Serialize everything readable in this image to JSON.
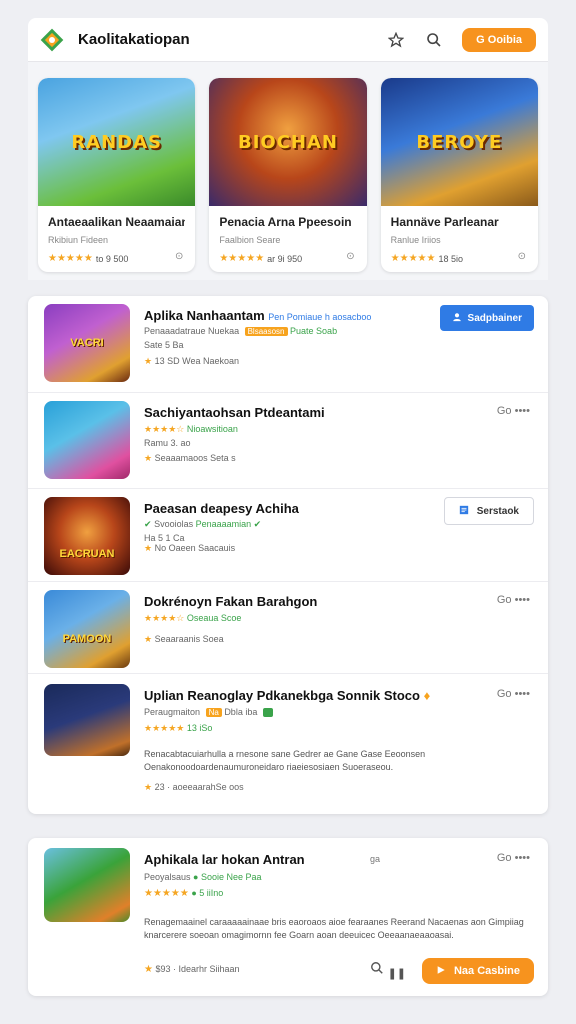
{
  "header": {
    "title": "Kaolitakatiopan",
    "star_icon": "star-outline-icon",
    "search_icon": "search-icon",
    "button_label": "G Ooibia"
  },
  "featured": [
    {
      "art_text": "RANDAS",
      "title": "Antaeaalikan Neaamaian",
      "sub": "Rkibiun Fideen",
      "stars": "★★★★★",
      "rating": "to 9 500",
      "more": "⊙",
      "colors": [
        "#4aa3e0",
        "#6bbf3a"
      ]
    },
    {
      "art_text": "BIOCHAN",
      "title": "Penacia Arna Ppeesoin",
      "sub": "Faalbion Seare",
      "stars": "★★★★★",
      "rating": "ar 9i 950",
      "more": "⊙",
      "colors": [
        "#b8461a",
        "#3a2a6a"
      ]
    },
    {
      "art_text": "BEROYE",
      "title": "Hannäve Parleanar",
      "sub": "Ranlue Iriios",
      "stars": "★★★★★",
      "rating": "18 5io",
      "more": "⊙",
      "colors": [
        "#2a5bb8",
        "#e0a030"
      ]
    }
  ],
  "list": [
    {
      "name": "Aplika Nanhaantam",
      "name_extra": "Pen Pomiaue h aosacboo",
      "meta1": "Penaaadatraue Nuekaa",
      "meta1_tag": "Blsaasosn",
      "meta1_extra": "Puate Soab",
      "meta2": "Sate 5 Ba",
      "meta3": "13 SD Wea Naekoan",
      "art_text": "VACRI",
      "button": "Sadpbainer",
      "colors": [
        "#8a3ec0",
        "#e0a030"
      ]
    },
    {
      "name": "Sachiyantaohsan Ptdeantami",
      "meta1": "★★★★☆",
      "meta1_green": "Nioawsitioan",
      "meta2": "Ramu 3. ao",
      "meta3": "Seaaamaoos Seta s",
      "actions": "Go ••••",
      "art_text": "",
      "colors": [
        "#29a0d8",
        "#e050a0"
      ]
    },
    {
      "name": "Paeasan deapesy Achiha",
      "meta1": "Svooiolas",
      "meta1_green": "Penaaaamian",
      "meta2": "Ha 5 1 Ca",
      "meta3": "No Oaeen Saacauis",
      "art_text": "EACRUAN",
      "button": "Serstaok",
      "colors": [
        "#5a1a10",
        "#e07a1a"
      ]
    },
    {
      "name": "Dokrénoyn Fakan Barahgon",
      "meta1": "★★★★☆",
      "meta1_extra": "Oseaua Scoe",
      "meta3": "Seaaraanis Soea",
      "actions": "Go ••••",
      "art_text": "PAMOON",
      "colors": [
        "#3a8ad8",
        "#e0a030"
      ]
    },
    {
      "name": "Uplian Reanoglay Pdkanekbga Sonnik Stoco",
      "meta1": "Peraugmaiton",
      "meta1_tag": "Na",
      "meta1_extra": "Dbla iba",
      "meta2": "★★★★★",
      "meta2_extra": "13 iSo",
      "actions": "Go ••••",
      "desc": "Renacabtacuiarhulla a rnesone sane Gedrer ae Gane Gase Eeoonsen Oenakonoodoardenaumuroneidaro riaeiesosiaen Suoeraseou.",
      "footer": "23 · aoeeaarahSe oos",
      "art_text": "",
      "colors": [
        "#1a2a5a",
        "#c0702a"
      ]
    }
  ],
  "bottom": {
    "name": "Aphikala lar hokan Antran",
    "name_extra": "ga",
    "actions": "Go ••••",
    "meta1": "Peoyalsaus",
    "meta1_green": "Sooie Nee Paa",
    "meta2": "★★★★★",
    "meta2_extra": "5 iiIno",
    "desc": "Renagemaainel caraaaaainaae bris eaoroaos aioe fearaanes Reerand Nacaenas aon Gimpiiag knarcerere soeoan omagimornn fee Goarn aoan deeuicec Oeeaanaeaaoasai.",
    "footer": "$93 · Idearhr Siihaan",
    "button": "Naa Casbine",
    "colors": [
      "#3aa33a",
      "#e0802a"
    ]
  }
}
